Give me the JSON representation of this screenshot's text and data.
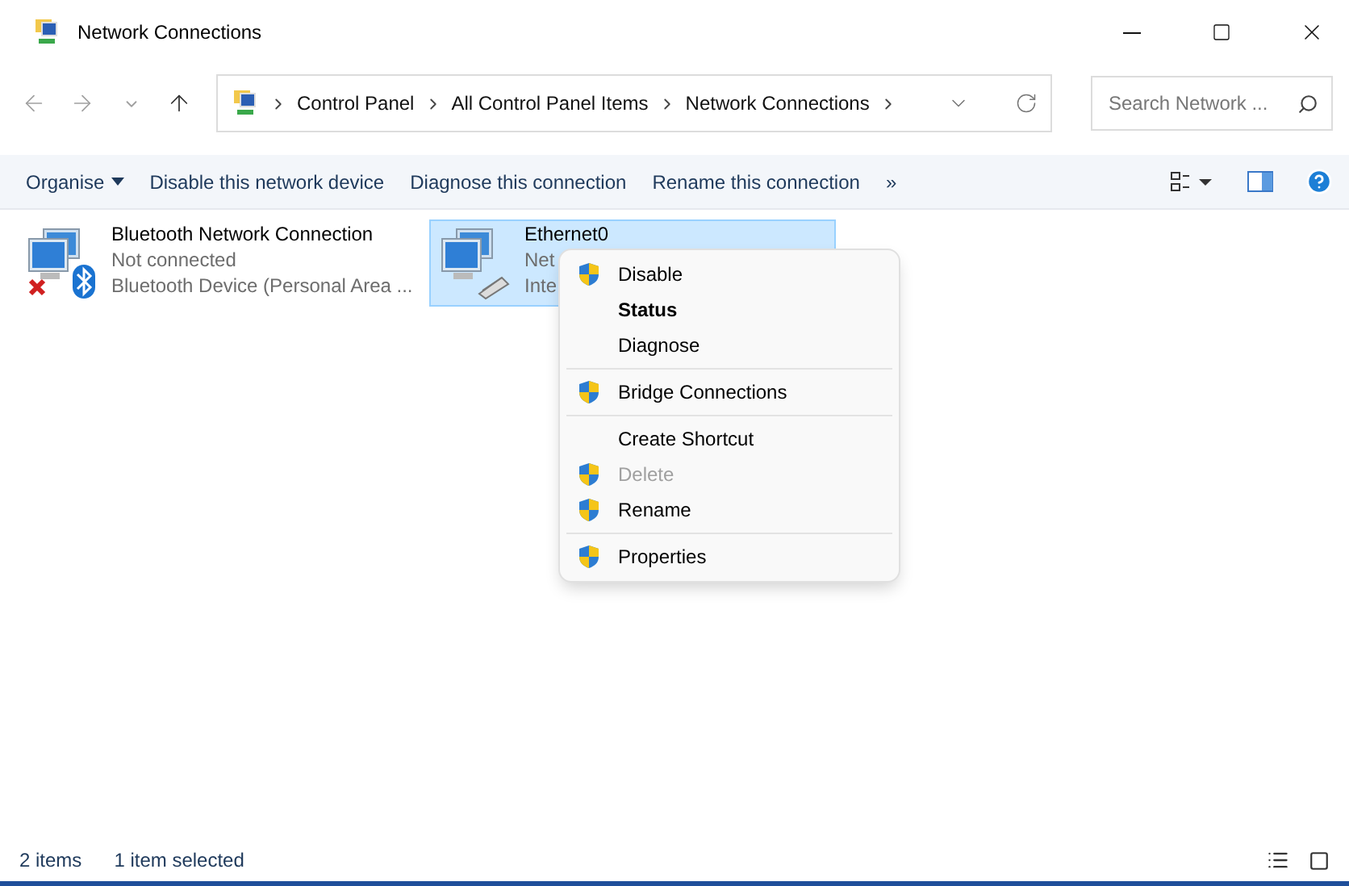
{
  "window": {
    "title": "Network Connections"
  },
  "address": {
    "crumbs": [
      "Control Panel",
      "All Control Panel Items",
      "Network Connections"
    ]
  },
  "search": {
    "placeholder": "Search Network ..."
  },
  "commands": [
    "Organise",
    "Disable this network device",
    "Diagnose this connection",
    "Rename this connection"
  ],
  "more": "»",
  "connections": [
    {
      "name": "Bluetooth Network Connection",
      "lines": [
        "Not connected",
        "Bluetooth Device (Personal Area ..."
      ],
      "kind": "bluetooth",
      "selected": false
    },
    {
      "name": "Ethernet0",
      "lines": [
        "Net",
        "Inte"
      ],
      "kind": "ethernet",
      "selected": true
    }
  ],
  "context_menu": [
    {
      "kind": "item",
      "label": "Disable",
      "shield": true,
      "default": false,
      "disabled": false
    },
    {
      "kind": "item",
      "label": "Status",
      "shield": false,
      "default": true,
      "disabled": false
    },
    {
      "kind": "item",
      "label": "Diagnose",
      "shield": false,
      "default": false,
      "disabled": false
    },
    {
      "kind": "separator"
    },
    {
      "kind": "item",
      "label": "Bridge Connections",
      "shield": true,
      "default": false,
      "disabled": false
    },
    {
      "kind": "separator"
    },
    {
      "kind": "item",
      "label": "Create Shortcut",
      "shield": false,
      "default": false,
      "disabled": false
    },
    {
      "kind": "item",
      "label": "Delete",
      "shield": true,
      "default": false,
      "disabled": true
    },
    {
      "kind": "item",
      "label": "Rename",
      "shield": true,
      "default": false,
      "disabled": false
    },
    {
      "kind": "separator"
    },
    {
      "kind": "item",
      "label": "Properties",
      "shield": true,
      "default": false,
      "disabled": false
    }
  ],
  "status_bar": {
    "count": "2 items",
    "selection": "1 item selected"
  }
}
